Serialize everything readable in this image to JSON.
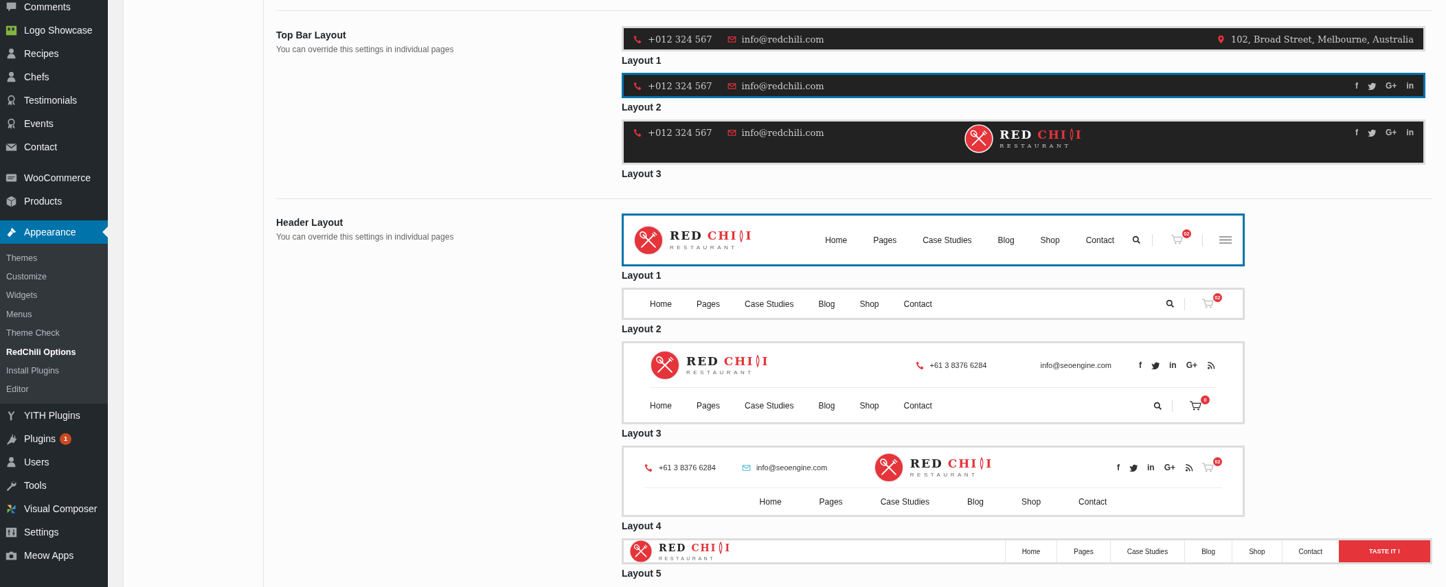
{
  "sidebar": {
    "items": [
      {
        "label": "Comments",
        "selected": false
      },
      {
        "label": "Logo Showcase",
        "selected": false
      },
      {
        "label": "Recipes",
        "selected": false
      },
      {
        "label": "Chefs",
        "selected": false
      },
      {
        "label": "Testimonials",
        "selected": false
      },
      {
        "label": "Events",
        "selected": false
      },
      {
        "label": "Contact",
        "selected": false
      },
      {
        "label": "WooCommerce",
        "selected": false
      },
      {
        "label": "Products",
        "selected": false
      },
      {
        "label": "Appearance",
        "selected": true,
        "children": [
          {
            "label": "Themes",
            "selected": false
          },
          {
            "label": "Customize",
            "selected": false
          },
          {
            "label": "Widgets",
            "selected": false
          },
          {
            "label": "Menus",
            "selected": false
          },
          {
            "label": "Theme Check",
            "selected": false
          },
          {
            "label": "RedChili Options",
            "selected": true
          },
          {
            "label": "Install Plugins",
            "selected": false
          },
          {
            "label": "Editor",
            "selected": false
          }
        ]
      },
      {
        "label": "YITH Plugins",
        "selected": false
      },
      {
        "label": "Plugins",
        "selected": false,
        "badge": "1"
      },
      {
        "label": "Users",
        "selected": false
      },
      {
        "label": "Tools",
        "selected": false
      },
      {
        "label": "Visual Composer",
        "selected": false
      },
      {
        "label": "Settings",
        "selected": false
      },
      {
        "label": "Meow Apps",
        "selected": false
      }
    ]
  },
  "sections": [
    {
      "title": "Top Bar Layout",
      "description": "You can override this settings in individual pages",
      "options": [
        {
          "caption": "Layout 1",
          "selected": false,
          "preview": {
            "kind": "topbar",
            "phone": "+012 324 567",
            "email": "info@redchili.com",
            "address": "102, Broad Street, Melbourne, Australia"
          }
        },
        {
          "caption": "Layout 2",
          "selected": true,
          "preview": {
            "kind": "topbar-social",
            "phone": "+012 324 567",
            "email": "info@redchili.com",
            "social": [
              {
                "kind": "text",
                "label": "f"
              },
              {
                "kind": "bird"
              },
              {
                "kind": "text",
                "label": "G+"
              },
              {
                "kind": "text",
                "label": "in"
              }
            ]
          }
        },
        {
          "caption": "Layout 3",
          "selected": false,
          "preview": {
            "kind": "topbar-logo",
            "phone": "+012 324 567",
            "email": "info@redchili.com",
            "logo": {
              "word1": "RED",
              "word2": "CHI",
              "word3": "I",
              "tagline": "RESTAURANT"
            },
            "social": [
              {
                "kind": "text",
                "label": "f"
              },
              {
                "kind": "bird"
              },
              {
                "kind": "text",
                "label": "G+"
              },
              {
                "kind": "text",
                "label": "in"
              }
            ]
          }
        }
      ]
    },
    {
      "title": "Header Layout",
      "description": "You can override this settings in individual pages",
      "options": [
        {
          "caption": "Layout 1",
          "selected": true,
          "preview": {
            "kind": "header-logo-nav",
            "logo": {
              "word1": "RED",
              "word2": "CHI",
              "word3": "I",
              "tagline": "RESTAURANT"
            },
            "nav": [
              "Home",
              "Pages",
              "Case Studies",
              "Blog",
              "Shop",
              "Contact"
            ],
            "cart_badge": "02"
          }
        },
        {
          "caption": "Layout 2",
          "selected": false,
          "preview": {
            "kind": "header-nav",
            "nav": [
              "Home",
              "Pages",
              "Case Studies",
              "Blog",
              "Shop",
              "Contact"
            ],
            "cart_badge": "02"
          }
        },
        {
          "caption": "Layout 3",
          "selected": false,
          "preview": {
            "kind": "header-logo-contact",
            "logo": {
              "word1": "RED",
              "word2": "CHI",
              "word3": "I",
              "tagline": "RESTAURANT"
            },
            "phone": "+61 3 8376 6284",
            "email": "info@seoengine.com",
            "social": [
              {
                "kind": "text",
                "label": "f"
              },
              {
                "kind": "bird"
              },
              {
                "kind": "text",
                "label": "in"
              },
              {
                "kind": "text",
                "label": "G+"
              },
              {
                "kind": "rss"
              }
            ],
            "nav": [
              "Home",
              "Pages",
              "Case Studies",
              "Blog",
              "Shop",
              "Contact"
            ],
            "cart_badge": "0"
          }
        },
        {
          "caption": "Layout 4",
          "selected": false,
          "preview": {
            "kind": "header-centered",
            "phone": "+61 3 8376 6284",
            "email": "info@seoengine.com",
            "logo": {
              "word1": "RED",
              "word2": "CHI",
              "word3": "I",
              "tagline": "RESTAURANT"
            },
            "social": [
              {
                "kind": "text",
                "label": "f"
              },
              {
                "kind": "bird"
              },
              {
                "kind": "text",
                "label": "in"
              },
              {
                "kind": "text",
                "label": "G+"
              },
              {
                "kind": "rss"
              }
            ],
            "cart_badge": "02",
            "nav": [
              "Home",
              "Pages",
              "Case Studies",
              "Blog",
              "Shop",
              "Contact"
            ]
          }
        },
        {
          "caption": "Layout 5",
          "selected": false,
          "preview": {
            "kind": "header-boxed",
            "logo": {
              "word1": "RED",
              "word2": "CHI",
              "word3": "I",
              "tagline": "RESTAURANT"
            },
            "nav": [
              "Home",
              "Pages",
              "Case Studies",
              "Blog",
              "Shop",
              "Contact"
            ],
            "cta": "TASTE IT !"
          }
        }
      ]
    }
  ]
}
